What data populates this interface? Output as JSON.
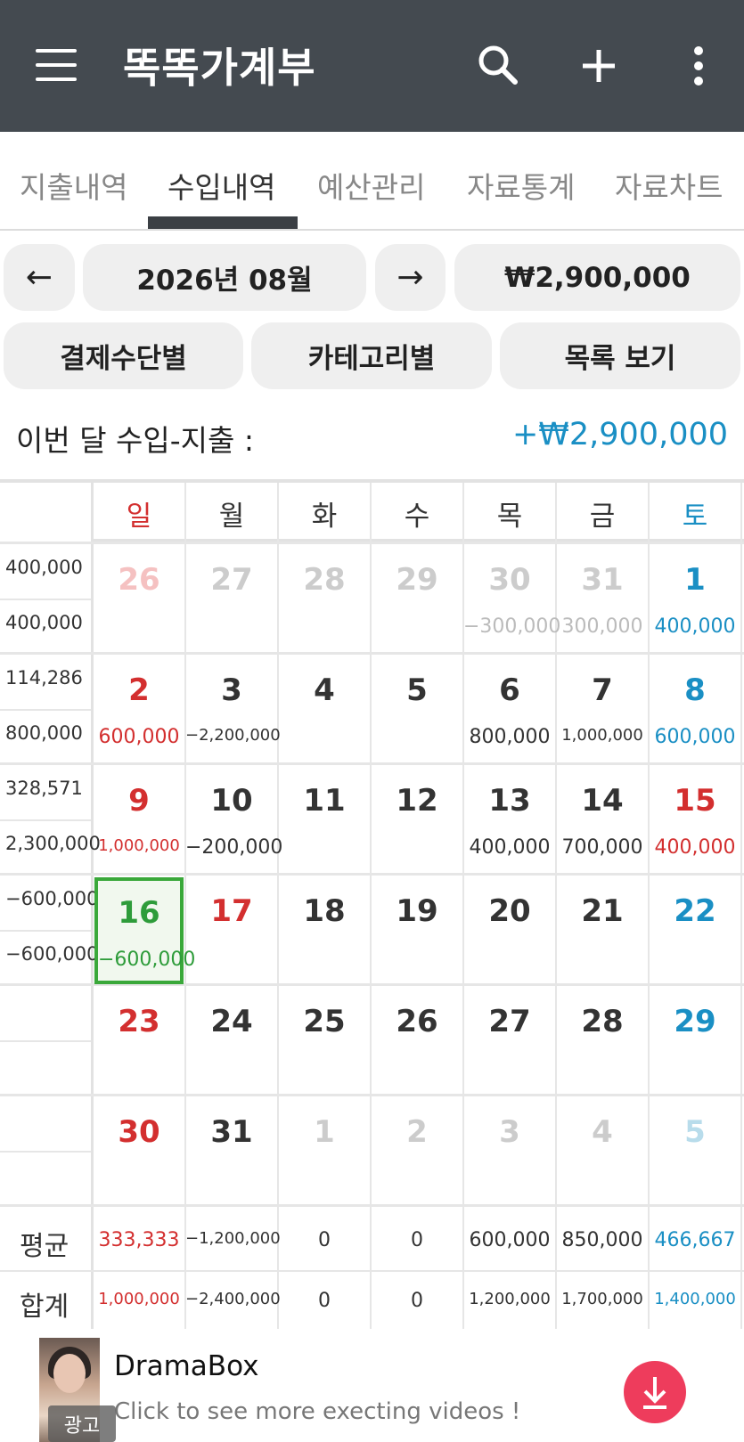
{
  "app": {
    "title": "똑똑가계부"
  },
  "tabs": [
    {
      "label": "지출내역"
    },
    {
      "label": "수입내역",
      "active": true
    },
    {
      "label": "예산관리"
    },
    {
      "label": "자료통계"
    },
    {
      "label": "자료차트"
    }
  ],
  "nav": {
    "prev_label": "←",
    "month_label": "2026년 08월",
    "next_label": "→",
    "total_label": "₩2,900,000"
  },
  "views": {
    "by_payment_label": "결제수단별",
    "by_category_label": "카테고리별",
    "list_label": "목록 보기"
  },
  "summary": {
    "net_label": "이번 달 수입-지출 :",
    "net_value": "+₩2,900,000"
  },
  "weekdays": [
    "일",
    "월",
    "화",
    "수",
    "목",
    "금",
    "토"
  ],
  "weeks": [
    {
      "avg": "400,000",
      "total": "400,000",
      "days": [
        {
          "day": "26",
          "amount": "",
          "dim": true
        },
        {
          "day": "27",
          "amount": "",
          "dim": true
        },
        {
          "day": "28",
          "amount": "",
          "dim": true
        },
        {
          "day": "29",
          "amount": "",
          "dim": true
        },
        {
          "day": "30",
          "amount": "−300,000",
          "dim": true
        },
        {
          "day": "31",
          "amount": "300,000",
          "dim": true
        },
        {
          "day": "1",
          "amount": "400,000"
        }
      ]
    },
    {
      "avg": "114,286",
      "total": "800,000",
      "days": [
        {
          "day": "2",
          "amount": "600,000"
        },
        {
          "day": "3",
          "amount": "−2,200,000"
        },
        {
          "day": "4",
          "amount": ""
        },
        {
          "day": "5",
          "amount": ""
        },
        {
          "day": "6",
          "amount": "800,000"
        },
        {
          "day": "7",
          "amount": "1,000,000"
        },
        {
          "day": "8",
          "amount": "600,000"
        }
      ]
    },
    {
      "avg": "328,571",
      "total": "2,300,000",
      "days": [
        {
          "day": "9",
          "amount": "1,000,000"
        },
        {
          "day": "10",
          "amount": "−200,000"
        },
        {
          "day": "11",
          "amount": ""
        },
        {
          "day": "12",
          "amount": ""
        },
        {
          "day": "13",
          "amount": "400,000"
        },
        {
          "day": "14",
          "amount": "700,000"
        },
        {
          "day": "15",
          "amount": "400,000",
          "holiday": true
        }
      ]
    },
    {
      "avg": "−600,000",
      "total": "−600,000",
      "days": [
        {
          "day": "16",
          "amount": "−600,000",
          "today": true
        },
        {
          "day": "17",
          "amount": "",
          "holiday": true
        },
        {
          "day": "18",
          "amount": ""
        },
        {
          "day": "19",
          "amount": ""
        },
        {
          "day": "20",
          "amount": ""
        },
        {
          "day": "21",
          "amount": ""
        },
        {
          "day": "22",
          "amount": ""
        }
      ]
    },
    {
      "avg": "",
      "total": "",
      "days": [
        {
          "day": "23",
          "amount": ""
        },
        {
          "day": "24",
          "amount": ""
        },
        {
          "day": "25",
          "amount": ""
        },
        {
          "day": "26",
          "amount": ""
        },
        {
          "day": "27",
          "amount": ""
        },
        {
          "day": "28",
          "amount": ""
        },
        {
          "day": "29",
          "amount": ""
        }
      ]
    },
    {
      "avg": "",
      "total": "",
      "days": [
        {
          "day": "30",
          "amount": ""
        },
        {
          "day": "31",
          "amount": ""
        },
        {
          "day": "1",
          "amount": "",
          "dim": true
        },
        {
          "day": "2",
          "amount": "",
          "dim": true
        },
        {
          "day": "3",
          "amount": "",
          "dim": true
        },
        {
          "day": "4",
          "amount": "",
          "dim": true
        },
        {
          "day": "5",
          "amount": "",
          "dim": true
        }
      ]
    }
  ],
  "average_row": {
    "label": "평균",
    "values": [
      "333,333",
      "−1,200,000",
      "0",
      "0",
      "600,000",
      "850,000",
      "466,667"
    ]
  },
  "total_row": {
    "label": "합계",
    "values": [
      "1,000,000",
      "−2,400,000",
      "0",
      "0",
      "1,200,000",
      "1,700,000",
      "1,400,000"
    ]
  },
  "ad": {
    "badge": "광고",
    "title": "DramaBox",
    "description": "Click to see more execting videos !"
  },
  "colors": {
    "appbar": "#444a50",
    "sunday": "#d32f2f",
    "saturday": "#1a8fc4",
    "today": "#3aa83a",
    "net_positive": "#1a8fc4",
    "download": "#ee3c5c"
  },
  "icons": {
    "menu": "menu-icon",
    "search": "search-icon",
    "add": "plus-icon",
    "more": "more-vert-icon",
    "download": "download-icon"
  }
}
